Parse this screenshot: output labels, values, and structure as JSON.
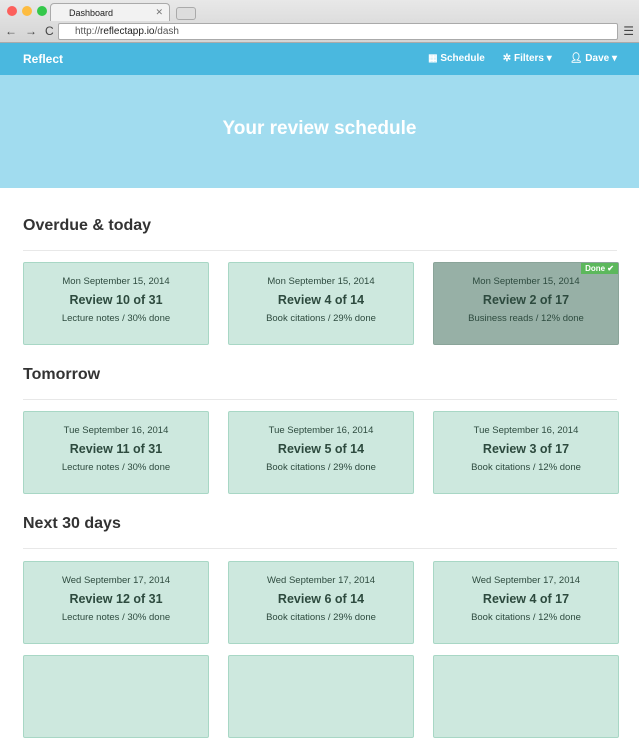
{
  "browser": {
    "tab_title": "Dashboard",
    "url_prefix": "http://",
    "url_host": "reflectapp.io",
    "url_path": "/dash"
  },
  "navbar": {
    "brand": "Reflect",
    "schedule": "Schedule",
    "filters": "Filters",
    "user": "Dave"
  },
  "hero": {
    "title": "Your review schedule"
  },
  "sections": [
    {
      "title": "Overdue & today",
      "cards": [
        {
          "date": "Mon September 15, 2014",
          "review": "Review 10 of 31",
          "sub": "Lecture notes / 30% done"
        },
        {
          "date": "Mon September 15, 2014",
          "review": "Review 4 of 14",
          "sub": "Book citations / 29% done"
        },
        {
          "date": "Mon September 15, 2014",
          "review": "Review 2 of 17",
          "sub": "Business reads / 12% done",
          "badge": "Done ✔"
        }
      ]
    },
    {
      "title": "Tomorrow",
      "cards": [
        {
          "date": "Tue September 16, 2014",
          "review": "Review 11 of 31",
          "sub": "Lecture notes / 30% done"
        },
        {
          "date": "Tue September 16, 2014",
          "review": "Review 5 of 14",
          "sub": "Book citations / 29% done"
        },
        {
          "date": "Tue September 16, 2014",
          "review": "Review 3 of 17",
          "sub": "Book citations / 12% done"
        }
      ]
    },
    {
      "title": "Next 30 days",
      "cards": [
        {
          "date": "Wed September 17, 2014",
          "review": "Review 12 of 31",
          "sub": "Lecture notes / 30% done"
        },
        {
          "date": "Wed September 17, 2014",
          "review": "Review 6 of 14",
          "sub": "Book citations / 29% done"
        },
        {
          "date": "Wed September 17, 2014",
          "review": "Review 4 of 17",
          "sub": "Book citations / 12% done"
        }
      ]
    }
  ]
}
